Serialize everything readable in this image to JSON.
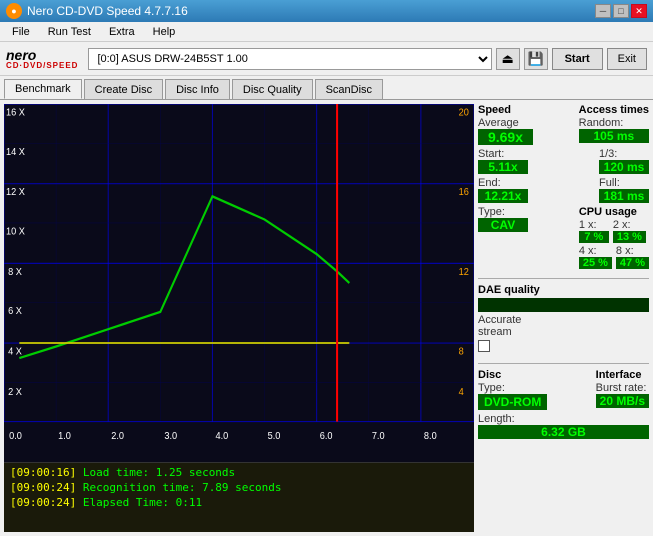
{
  "titleBar": {
    "title": "Nero CD-DVD Speed 4.7.7.16",
    "icon": "●"
  },
  "menuBar": {
    "items": [
      "File",
      "Run Test",
      "Extra",
      "Help"
    ]
  },
  "toolbar": {
    "nero": "nero",
    "neroSub": "CD·DVD/SPEED",
    "drive": "[0:0]  ASUS DRW-24B5ST 1.00",
    "startLabel": "Start",
    "exitLabel": "Exit"
  },
  "tabs": {
    "items": [
      "Benchmark",
      "Create Disc",
      "Disc Info",
      "Disc Quality",
      "ScanDisc"
    ],
    "active": 0
  },
  "chart": {
    "yLabels": [
      "16 X",
      "14 X",
      "12 X",
      "10 X",
      "8 X",
      "6 X",
      "4 X",
      "2 X"
    ],
    "xLabels": [
      "0.0",
      "1.0",
      "2.0",
      "3.0",
      "4.0",
      "5.0",
      "6.0",
      "7.0",
      "8.0"
    ],
    "rightLabels": [
      "20",
      "16",
      "12",
      "8",
      "4"
    ],
    "redLineX": 6.3
  },
  "stats": {
    "speedHeader": "Speed",
    "avgLabel": "Average",
    "avgValue": "9.69x",
    "startLabel": "Start:",
    "startValue": "5.11x",
    "endLabel": "End:",
    "endValue": "12.21x",
    "typeLabel": "Type:",
    "typeValue": "CAV",
    "accessHeader": "Access times",
    "randomLabel": "Random:",
    "randomValue": "105 ms",
    "oneThirdLabel": "1/3:",
    "oneThirdValue": "120 ms",
    "fullLabel": "Full:",
    "fullValue": "181 ms",
    "cpuHeader": "CPU usage",
    "cpu1x": "1 x:",
    "cpu1xVal": "7 %",
    "cpu2x": "2 x:",
    "cpu2xVal": "13 %",
    "cpu4x": "4 x:",
    "cpu4xVal": "25 %",
    "cpu8x": "8 x:",
    "cpu8xVal": "47 %",
    "daeHeader": "DAE quality",
    "accurateLabel": "Accurate",
    "streamLabel": "stream",
    "discHeader": "Disc",
    "discTypeLabel": "Type:",
    "discTypeValue": "DVD-ROM",
    "discLengthLabel": "Length:",
    "discLengthValue": "6.32 GB",
    "interfaceHeader": "Interface",
    "burstLabel": "Burst rate:",
    "burstValue": "20 MB/s"
  },
  "log": {
    "lines": [
      {
        "time": "[09:00:16]",
        "text": " Load time: 1.25 seconds"
      },
      {
        "time": "[09:00:24]",
        "text": " Recognition time: 7.89 seconds"
      },
      {
        "time": "[09:00:24]",
        "text": " Elapsed Time: 0:11"
      }
    ]
  }
}
